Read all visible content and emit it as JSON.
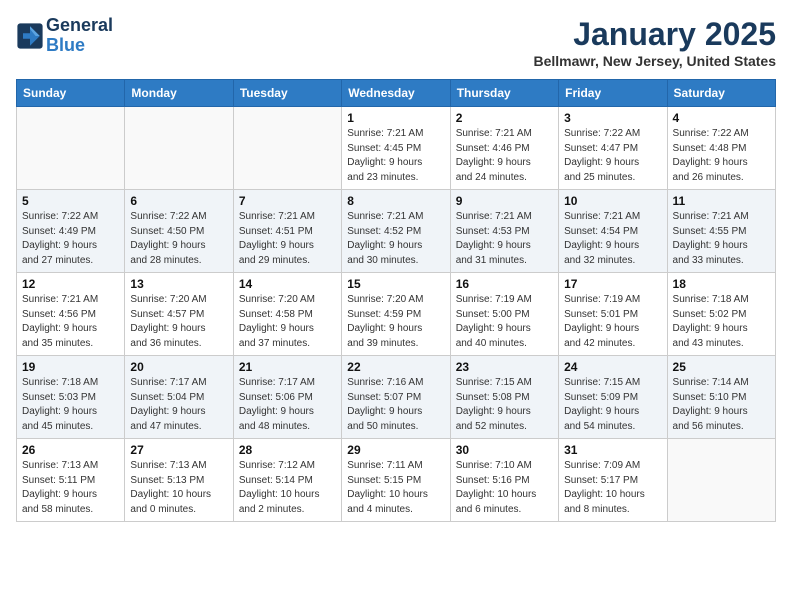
{
  "header": {
    "logo_line1": "General",
    "logo_line2": "Blue",
    "month": "January 2025",
    "location": "Bellmawr, New Jersey, United States"
  },
  "weekdays": [
    "Sunday",
    "Monday",
    "Tuesday",
    "Wednesday",
    "Thursday",
    "Friday",
    "Saturday"
  ],
  "weeks": [
    {
      "shaded": false,
      "days": [
        {
          "num": "",
          "info": ""
        },
        {
          "num": "",
          "info": ""
        },
        {
          "num": "",
          "info": ""
        },
        {
          "num": "1",
          "info": "Sunrise: 7:21 AM\nSunset: 4:45 PM\nDaylight: 9 hours\nand 23 minutes."
        },
        {
          "num": "2",
          "info": "Sunrise: 7:21 AM\nSunset: 4:46 PM\nDaylight: 9 hours\nand 24 minutes."
        },
        {
          "num": "3",
          "info": "Sunrise: 7:22 AM\nSunset: 4:47 PM\nDaylight: 9 hours\nand 25 minutes."
        },
        {
          "num": "4",
          "info": "Sunrise: 7:22 AM\nSunset: 4:48 PM\nDaylight: 9 hours\nand 26 minutes."
        }
      ]
    },
    {
      "shaded": true,
      "days": [
        {
          "num": "5",
          "info": "Sunrise: 7:22 AM\nSunset: 4:49 PM\nDaylight: 9 hours\nand 27 minutes."
        },
        {
          "num": "6",
          "info": "Sunrise: 7:22 AM\nSunset: 4:50 PM\nDaylight: 9 hours\nand 28 minutes."
        },
        {
          "num": "7",
          "info": "Sunrise: 7:21 AM\nSunset: 4:51 PM\nDaylight: 9 hours\nand 29 minutes."
        },
        {
          "num": "8",
          "info": "Sunrise: 7:21 AM\nSunset: 4:52 PM\nDaylight: 9 hours\nand 30 minutes."
        },
        {
          "num": "9",
          "info": "Sunrise: 7:21 AM\nSunset: 4:53 PM\nDaylight: 9 hours\nand 31 minutes."
        },
        {
          "num": "10",
          "info": "Sunrise: 7:21 AM\nSunset: 4:54 PM\nDaylight: 9 hours\nand 32 minutes."
        },
        {
          "num": "11",
          "info": "Sunrise: 7:21 AM\nSunset: 4:55 PM\nDaylight: 9 hours\nand 33 minutes."
        }
      ]
    },
    {
      "shaded": false,
      "days": [
        {
          "num": "12",
          "info": "Sunrise: 7:21 AM\nSunset: 4:56 PM\nDaylight: 9 hours\nand 35 minutes."
        },
        {
          "num": "13",
          "info": "Sunrise: 7:20 AM\nSunset: 4:57 PM\nDaylight: 9 hours\nand 36 minutes."
        },
        {
          "num": "14",
          "info": "Sunrise: 7:20 AM\nSunset: 4:58 PM\nDaylight: 9 hours\nand 37 minutes."
        },
        {
          "num": "15",
          "info": "Sunrise: 7:20 AM\nSunset: 4:59 PM\nDaylight: 9 hours\nand 39 minutes."
        },
        {
          "num": "16",
          "info": "Sunrise: 7:19 AM\nSunset: 5:00 PM\nDaylight: 9 hours\nand 40 minutes."
        },
        {
          "num": "17",
          "info": "Sunrise: 7:19 AM\nSunset: 5:01 PM\nDaylight: 9 hours\nand 42 minutes."
        },
        {
          "num": "18",
          "info": "Sunrise: 7:18 AM\nSunset: 5:02 PM\nDaylight: 9 hours\nand 43 minutes."
        }
      ]
    },
    {
      "shaded": true,
      "days": [
        {
          "num": "19",
          "info": "Sunrise: 7:18 AM\nSunset: 5:03 PM\nDaylight: 9 hours\nand 45 minutes."
        },
        {
          "num": "20",
          "info": "Sunrise: 7:17 AM\nSunset: 5:04 PM\nDaylight: 9 hours\nand 47 minutes."
        },
        {
          "num": "21",
          "info": "Sunrise: 7:17 AM\nSunset: 5:06 PM\nDaylight: 9 hours\nand 48 minutes."
        },
        {
          "num": "22",
          "info": "Sunrise: 7:16 AM\nSunset: 5:07 PM\nDaylight: 9 hours\nand 50 minutes."
        },
        {
          "num": "23",
          "info": "Sunrise: 7:15 AM\nSunset: 5:08 PM\nDaylight: 9 hours\nand 52 minutes."
        },
        {
          "num": "24",
          "info": "Sunrise: 7:15 AM\nSunset: 5:09 PM\nDaylight: 9 hours\nand 54 minutes."
        },
        {
          "num": "25",
          "info": "Sunrise: 7:14 AM\nSunset: 5:10 PM\nDaylight: 9 hours\nand 56 minutes."
        }
      ]
    },
    {
      "shaded": false,
      "days": [
        {
          "num": "26",
          "info": "Sunrise: 7:13 AM\nSunset: 5:11 PM\nDaylight: 9 hours\nand 58 minutes."
        },
        {
          "num": "27",
          "info": "Sunrise: 7:13 AM\nSunset: 5:13 PM\nDaylight: 10 hours\nand 0 minutes."
        },
        {
          "num": "28",
          "info": "Sunrise: 7:12 AM\nSunset: 5:14 PM\nDaylight: 10 hours\nand 2 minutes."
        },
        {
          "num": "29",
          "info": "Sunrise: 7:11 AM\nSunset: 5:15 PM\nDaylight: 10 hours\nand 4 minutes."
        },
        {
          "num": "30",
          "info": "Sunrise: 7:10 AM\nSunset: 5:16 PM\nDaylight: 10 hours\nand 6 minutes."
        },
        {
          "num": "31",
          "info": "Sunrise: 7:09 AM\nSunset: 5:17 PM\nDaylight: 10 hours\nand 8 minutes."
        },
        {
          "num": "",
          "info": ""
        }
      ]
    }
  ]
}
